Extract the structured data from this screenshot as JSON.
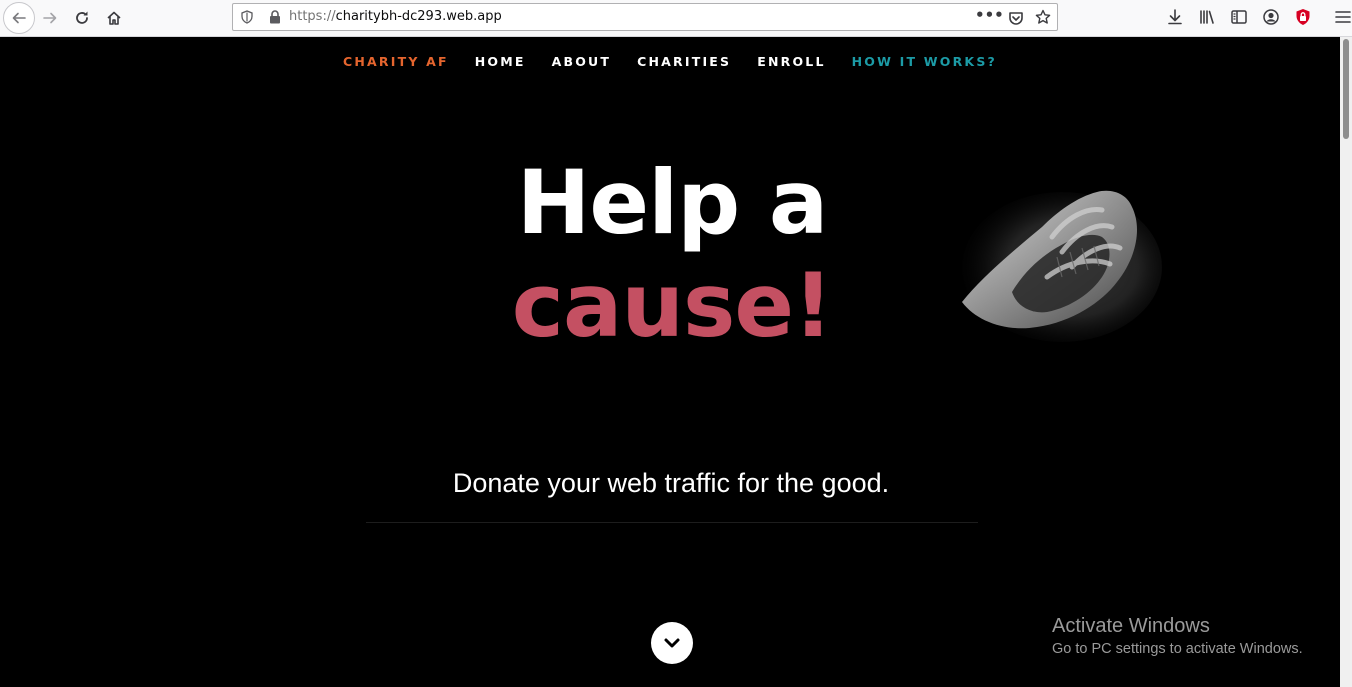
{
  "browser": {
    "url_scheme": "https://",
    "url_host": "charitybh-dc293.web.app",
    "page_actions": "•••"
  },
  "nav": {
    "items": [
      {
        "label": "CHARITY AF"
      },
      {
        "label": "HOME"
      },
      {
        "label": "ABOUT"
      },
      {
        "label": "CHARITIES"
      },
      {
        "label": "ENROLL"
      },
      {
        "label": "HOW IT WORKS?"
      }
    ]
  },
  "hero": {
    "line1": "Help a",
    "line2": "cause!",
    "tagline": "Donate your web traffic for the good."
  },
  "watermark": {
    "title": "Activate Windows",
    "subtitle": "Go to PC settings to activate Windows."
  },
  "colors": {
    "brand": "#e5652e",
    "accent": "#1c9ba6",
    "cause": "#c45062",
    "background": "#000000"
  }
}
